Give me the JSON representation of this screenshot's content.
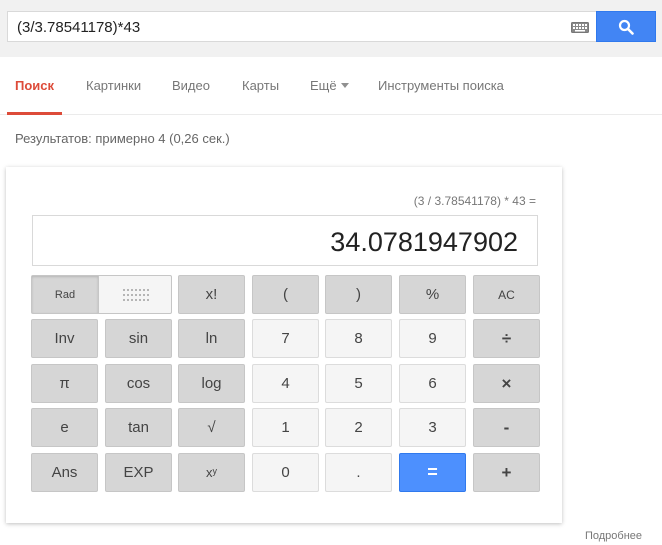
{
  "search": {
    "query": "(3/3.78541178)*43"
  },
  "tabs": [
    {
      "label": "Поиск"
    },
    {
      "label": "Картинки"
    },
    {
      "label": "Видео"
    },
    {
      "label": "Карты"
    },
    {
      "label": "Ещё"
    },
    {
      "label": "Инструменты поиска"
    }
  ],
  "results_stats": "Результатов: примерно 4 (0,26 сек.)",
  "calculator": {
    "history": "(3 / 3.78541178) * 43 =",
    "result": "34.0781947902",
    "mode": "Rad",
    "keys": {
      "r1": [
        "x!",
        "(",
        ")",
        "%",
        "AC"
      ],
      "r2": [
        "Inv",
        "sin",
        "ln",
        "7",
        "8",
        "9",
        "÷"
      ],
      "r3": [
        "π",
        "cos",
        "log",
        "4",
        "5",
        "6",
        "×"
      ],
      "r4": [
        "e",
        "tan",
        "√",
        "1",
        "2",
        "3",
        "-"
      ],
      "r5": [
        "Ans",
        "EXP",
        "0",
        ".",
        "=",
        "+"
      ]
    },
    "pow_base": "x",
    "pow_exp": "y"
  },
  "footer": {
    "more_link": "Подробнее"
  },
  "colors": {
    "accent_red": "#dd4b39",
    "search_blue": "#4285f4",
    "equals_blue": "#4d90fe"
  }
}
